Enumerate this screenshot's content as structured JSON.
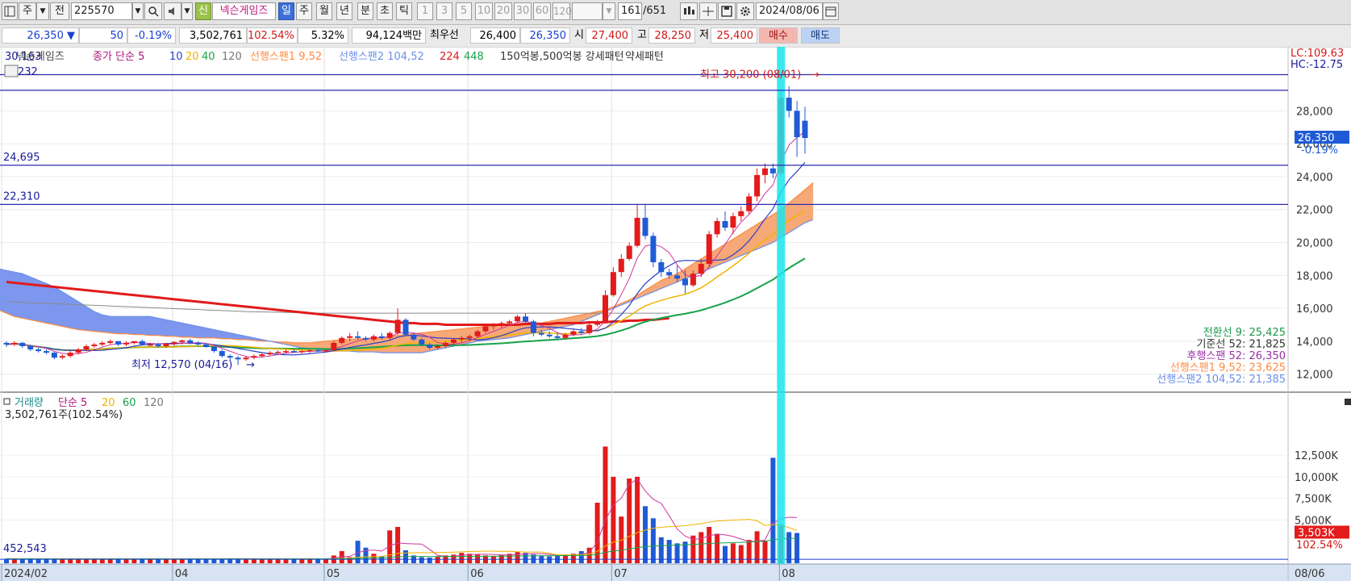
{
  "toolbar": {
    "ju": "주",
    "jeon": "전",
    "code": "225570",
    "badge_new": "신",
    "stock_name": "넥슨게임즈",
    "periods": [
      "일",
      "주",
      "월",
      "년",
      "분",
      "초",
      "틱"
    ],
    "minute_intervals": [
      "1",
      "3",
      "5",
      "10",
      "20",
      "30",
      "60",
      "120"
    ],
    "count": "161",
    "total": "/651",
    "date": "2024/08/06"
  },
  "quote": {
    "price": "26,350",
    "arrow": "▼",
    "change": "50",
    "change_pct": "-0.19%",
    "volume": "3,502,761",
    "vol_ratio": "102.54%",
    "turnover": "5.32%",
    "amount": "94,124백만",
    "best_label": "최우선",
    "ask": "26,400",
    "bid": "26,350",
    "open_label": "시",
    "open": "27,400",
    "high_label": "고",
    "high": "28,250",
    "low_label": "저",
    "low": "25,400",
    "buy": "매수",
    "sell": "매도"
  },
  "legend": {
    "name": "넥슨게임즈",
    "ma_label": "종가 단순 5",
    "ma10": "10",
    "ma20": "20",
    "ma40": "40",
    "ma120": "120",
    "span1": "선행스팬1 9,52",
    "span2": "선행스팬2 104,52",
    "p224": "224",
    "p448": "448",
    "pattern": "150억봉,500억봉 강세패턴",
    "weak": "약세패턴",
    "overlap": "30,163",
    "overlap2": "232"
  },
  "price_labels": {
    "lc": "LC:109.63",
    "hc": "HC:-12.75",
    "cur": "26,350",
    "cur_pct": "-0.19%",
    "h1": "24,695",
    "h2": "22,310",
    "high_note": "최고 30,200 (08/01)",
    "low_note": "최저 12,570 (04/16)"
  },
  "ichimoku_legend": [
    {
      "text": "전환선 9: 25,425",
      "color": "#1a9a4a"
    },
    {
      "text": "기준선 52: 21,825",
      "color": "#333333"
    },
    {
      "text": "후행스팬 52: 26,350",
      "color": "#9b2fa8"
    },
    {
      "text": "선행스팬1 9,52: 23,625",
      "color": "#ff8a40"
    },
    {
      "text": "선행스팬2 104,52: 21,385",
      "color": "#6c8fe8"
    }
  ],
  "volume_legend": {
    "label": "거래량",
    "ma": "단순 5",
    "m20": "20",
    "m60": "60",
    "m120": "120",
    "value": "3,502,761주(102.54%)",
    "min": "452,543",
    "cur": "3,503K",
    "cur_pct": "102.54%"
  },
  "x_labels": [
    "2024/02",
    "04",
    "05",
    "06",
    "07",
    "08",
    "08/06"
  ],
  "chart_data": [
    {
      "type": "candlestick",
      "title": "",
      "ylim": [
        11000,
        31500
      ],
      "y_ticks": [
        "28,000",
        "26,000",
        "24,000",
        "22,000",
        "20,000",
        "18,000",
        "16,000",
        "14,000",
        "12,000"
      ],
      "x_labels": [
        "2024/02",
        "04",
        "05",
        "06",
        "07",
        "08"
      ],
      "candles": [
        [
          13900,
          14000,
          13650,
          13800
        ],
        [
          13800,
          14000,
          13700,
          13900
        ],
        [
          13900,
          13950,
          13600,
          13700
        ],
        [
          13700,
          13800,
          13400,
          13500
        ],
        [
          13500,
          13600,
          13300,
          13400
        ],
        [
          13400,
          13500,
          13200,
          13300
        ],
        [
          13300,
          13350,
          12900,
          13000
        ],
        [
          13000,
          13200,
          12900,
          13100
        ],
        [
          13100,
          13400,
          13000,
          13300
        ],
        [
          13300,
          13600,
          13200,
          13500
        ],
        [
          13500,
          13800,
          13400,
          13700
        ],
        [
          13700,
          13900,
          13600,
          13800
        ],
        [
          13800,
          14000,
          13700,
          13900
        ],
        [
          13900,
          14100,
          13800,
          14000
        ],
        [
          14000,
          14000,
          13700,
          13800
        ],
        [
          13800,
          14000,
          13700,
          13900
        ],
        [
          13900,
          14000,
          13800,
          14000
        ],
        [
          14000,
          14100,
          13800,
          13800
        ],
        [
          13800,
          13900,
          13700,
          13800
        ],
        [
          13800,
          13900,
          13600,
          13700
        ],
        [
          13700,
          13900,
          13600,
          13850
        ],
        [
          13850,
          14000,
          13700,
          13950
        ],
        [
          13950,
          14100,
          13800,
          14050
        ],
        [
          14050,
          14150,
          13800,
          13900
        ],
        [
          13900,
          14000,
          13700,
          13800
        ],
        [
          13800,
          13900,
          13600,
          13650
        ],
        [
          13650,
          13700,
          13300,
          13400
        ],
        [
          13400,
          13500,
          13000,
          13100
        ],
        [
          13100,
          13200,
          12800,
          13000
        ],
        [
          13000,
          13100,
          12570,
          12900
        ],
        [
          12900,
          13100,
          12800,
          13000
        ],
        [
          13000,
          13200,
          12900,
          13100
        ],
        [
          13100,
          13300,
          13000,
          13200
        ],
        [
          13200,
          13400,
          13100,
          13300
        ],
        [
          13300,
          13450,
          13200,
          13350
        ],
        [
          13350,
          13500,
          13250,
          13400
        ],
        [
          13400,
          13500,
          13300,
          13350
        ],
        [
          13350,
          13450,
          13250,
          13400
        ],
        [
          13400,
          13500,
          13300,
          13450
        ],
        [
          13450,
          13550,
          13350,
          13400
        ],
        [
          13400,
          13500,
          13300,
          13450
        ],
        [
          13450,
          14000,
          13400,
          13900
        ],
        [
          13900,
          14300,
          13800,
          14200
        ],
        [
          14200,
          14500,
          14000,
          14300
        ],
        [
          14300,
          14600,
          14100,
          14200
        ],
        [
          14200,
          14300,
          14000,
          14100
        ],
        [
          14100,
          14400,
          14000,
          14300
        ],
        [
          14300,
          14500,
          14100,
          14200
        ],
        [
          14200,
          14600,
          14100,
          14500
        ],
        [
          14500,
          16000,
          14400,
          15300
        ],
        [
          15300,
          15400,
          14300,
          14400
        ],
        [
          14400,
          14500,
          14000,
          14100
        ],
        [
          14100,
          14200,
          13700,
          13800
        ],
        [
          13800,
          13900,
          13500,
          13600
        ],
        [
          13600,
          13800,
          13500,
          13700
        ],
        [
          13700,
          14000,
          13600,
          13900
        ],
        [
          13900,
          14200,
          13800,
          14100
        ],
        [
          14100,
          14300,
          13900,
          14200
        ],
        [
          14200,
          14400,
          14000,
          14300
        ],
        [
          14300,
          14700,
          14200,
          14600
        ],
        [
          14600,
          15000,
          14500,
          14900
        ],
        [
          14900,
          15100,
          14700,
          15000
        ],
        [
          15000,
          15200,
          14800,
          15100
        ],
        [
          15100,
          15300,
          14900,
          15200
        ],
        [
          15200,
          15600,
          15100,
          15500
        ],
        [
          15500,
          15700,
          15100,
          15200
        ],
        [
          15200,
          15300,
          14300,
          14500
        ],
        [
          14500,
          14700,
          14300,
          14400
        ],
        [
          14400,
          14600,
          14200,
          14300
        ],
        [
          14300,
          14500,
          14100,
          14200
        ],
        [
          14200,
          14500,
          14100,
          14400
        ],
        [
          14400,
          14700,
          14300,
          14600
        ],
        [
          14600,
          14800,
          14400,
          14500
        ],
        [
          14500,
          15100,
          14400,
          15000
        ],
        [
          15000,
          15300,
          14900,
          15200
        ],
        [
          15200,
          17100,
          15100,
          16800
        ],
        [
          16800,
          18500,
          16700,
          18200
        ],
        [
          18200,
          19300,
          17900,
          19000
        ],
        [
          19000,
          20000,
          18900,
          19800
        ],
        [
          19800,
          22300,
          19700,
          21500
        ],
        [
          21500,
          22300,
          20200,
          20400
        ],
        [
          20400,
          20600,
          18500,
          18800
        ],
        [
          18800,
          19000,
          17900,
          18200
        ],
        [
          18200,
          18400,
          17800,
          18000
        ],
        [
          18000,
          18600,
          17600,
          17800
        ],
        [
          17800,
          18300,
          16900,
          17400
        ],
        [
          17400,
          18300,
          17300,
          18100
        ],
        [
          18100,
          19000,
          17900,
          18700
        ],
        [
          18700,
          20700,
          18500,
          20500
        ],
        [
          20500,
          21500,
          20300,
          21300
        ],
        [
          21300,
          21900,
          20700,
          20900
        ],
        [
          20900,
          21800,
          20500,
          21600
        ],
        [
          21600,
          22200,
          21300,
          21900
        ],
        [
          21900,
          23000,
          21700,
          22800
        ],
        [
          22800,
          24500,
          22500,
          24100
        ],
        [
          24100,
          24800,
          23600,
          24500
        ],
        [
          24500,
          24800,
          23900,
          24200
        ],
        [
          24200,
          29200,
          24000,
          28800
        ],
        [
          28800,
          29500,
          27600,
          28000
        ],
        [
          28000,
          28600,
          25200,
          26400
        ],
        [
          27400,
          28250,
          25400,
          26350
        ]
      ],
      "ichimoku_span1": [
        17000,
        16900,
        16800,
        16700,
        16500,
        16300,
        16100,
        15900,
        15700,
        15500,
        15400,
        15300,
        15200,
        15100,
        15000,
        14900,
        14800,
        14700,
        14650,
        14600,
        14550,
        14500,
        14450,
        14450,
        14400,
        14400,
        14350,
        14350,
        14300,
        14300,
        14250,
        14250,
        14200,
        14200,
        14200,
        14150,
        14150,
        14100,
        14100,
        14050,
        14000,
        14000,
        13950,
        13950,
        13900,
        13900,
        13900,
        13950,
        14000,
        14050,
        14100,
        14100,
        14150,
        14150,
        14200,
        14200,
        14300,
        14350,
        14400,
        14450,
        14500,
        14550,
        14600,
        14650,
        14700,
        14750,
        14800,
        14850,
        14900,
        14950,
        15000,
        15050,
        15050,
        15100,
        15100,
        15100,
        15200,
        15300,
        15400,
        15500,
        15600,
        15700,
        15800,
        15900,
        16100,
        16300,
        16500,
        16800,
        17100,
        17400,
        17700,
        17900,
        18100,
        18400,
        18700,
        19000,
        19300,
        19600,
        19900,
        20200,
        20500,
        20800,
        21100,
        21400,
        21700,
        22000,
        22400,
        22800,
        23200,
        23625
      ],
      "ichimoku_span2": [
        18500,
        18500,
        18500,
        18500,
        18500,
        18500,
        18500,
        18400,
        18300,
        18200,
        18100,
        17900,
        17700,
        17500,
        17300,
        17000,
        16700,
        16400,
        16100,
        15800,
        15600,
        15500,
        15500,
        15500,
        15500,
        15500,
        15500,
        15400,
        15300,
        15200,
        15100,
        15000,
        14900,
        14800,
        14700,
        14600,
        14500,
        14400,
        14300,
        14200,
        14100,
        14000,
        13900,
        13800,
        13700,
        13600,
        13550,
        13500,
        13450,
        13400,
        13400,
        13400,
        13350,
        13350,
        13350,
        13300,
        13300,
        13300,
        13300,
        13300,
        13300,
        13400,
        13500,
        13600,
        13700,
        13800,
        13900,
        14000,
        14050,
        14100,
        14150,
        14200,
        14300,
        14400,
        14500,
        14600,
        14700,
        14800,
        14900,
        15000,
        15200,
        15400,
        15600,
        15800,
        16000,
        16200,
        16400,
        16600,
        16800,
        17000,
        17200,
        17400,
        17600,
        17800,
        18000,
        18200,
        18400,
        18600,
        18800,
        19000,
        19200,
        19400,
        19600,
        19800,
        20000,
        20300,
        20600,
        20900,
        21200,
        21385
      ],
      "ma224": [
        17600,
        17550,
        17500,
        17450,
        17400,
        17350,
        17300,
        17250,
        17200,
        17150,
        17100,
        17050,
        17000,
        16950,
        16900,
        16850,
        16800,
        16750,
        16700,
        16650,
        16600,
        16550,
        16500,
        16450,
        16400,
        16350,
        16300,
        16250,
        16200,
        16150,
        16100,
        16050,
        16000,
        15950,
        15900,
        15850,
        15800,
        15750,
        15700,
        15650,
        15600,
        15550,
        15500,
        15450,
        15400,
        15350,
        15300,
        15250,
        15200,
        15150,
        15100,
        15100,
        15050,
        15050,
        15050,
        15000,
        15000,
        15000,
        15000,
        15000,
        15000,
        15000,
        15000,
        15000,
        15000,
        15050,
        15050,
        15050,
        15050,
        15100,
        15100,
        15100,
        15100,
        15150,
        15150,
        15150,
        15200,
        15200,
        15250,
        15250,
        15300,
        15300,
        15350,
        15400
      ],
      "ma448": [
        16400,
        16380,
        16360,
        16340,
        16320,
        16300,
        16280,
        16260,
        16240,
        16220,
        16200,
        16180,
        16160,
        16140,
        16120,
        16100,
        16080,
        16060,
        16040,
        16020,
        16000,
        15980,
        15960,
        15940,
        15920,
        15900,
        15880,
        15860,
        15840,
        15820,
        15800,
        15790,
        15780,
        15770,
        15760,
        15750,
        15740,
        15730,
        15720,
        15710,
        15700,
        15700,
        15700,
        15700,
        15700,
        15700,
        15700,
        15700,
        15700,
        15700,
        15700,
        15700,
        15700,
        15700,
        15700,
        15700,
        15700,
        15700,
        15700,
        15700,
        15700,
        15700,
        15700,
        15700,
        15700,
        15700,
        15700,
        15700,
        15700,
        15700,
        15700,
        15700,
        15700,
        15700,
        15700,
        15700,
        15700,
        15700,
        15700,
        15700,
        15700,
        15700,
        15700,
        15700
      ]
    },
    {
      "type": "bar",
      "title": "",
      "ylim": [
        0,
        14000
      ],
      "y_ticks": [
        "12,500K",
        "10,000K",
        "7,500K",
        "5,000K"
      ],
      "values": [
        520,
        510,
        500,
        505,
        495,
        500,
        520,
        510,
        505,
        500,
        495,
        500,
        510,
        505,
        500,
        495,
        490,
        500,
        505,
        510,
        500,
        495,
        505,
        515,
        510,
        500,
        520,
        530,
        540,
        520,
        510,
        505,
        500,
        495,
        500,
        505,
        510,
        505,
        500,
        495,
        505,
        900,
        1400,
        700,
        2600,
        1800,
        1100,
        800,
        3800,
        4200,
        1500,
        900,
        700,
        650,
        800,
        900,
        1000,
        1200,
        1100,
        1000,
        900,
        850,
        950,
        1100,
        1300,
        1200,
        1000,
        900,
        800,
        900,
        1000,
        1100,
        1400,
        1800,
        7000,
        13500,
        10000,
        5400,
        9800,
        10000,
        6600,
        5200,
        3000,
        2700,
        2300,
        2500,
        3200,
        3600,
        4200,
        3400,
        2000,
        2300,
        2100,
        2700,
        3700,
        2600,
        12200,
        4500,
        3600,
        3503
      ]
    }
  ]
}
